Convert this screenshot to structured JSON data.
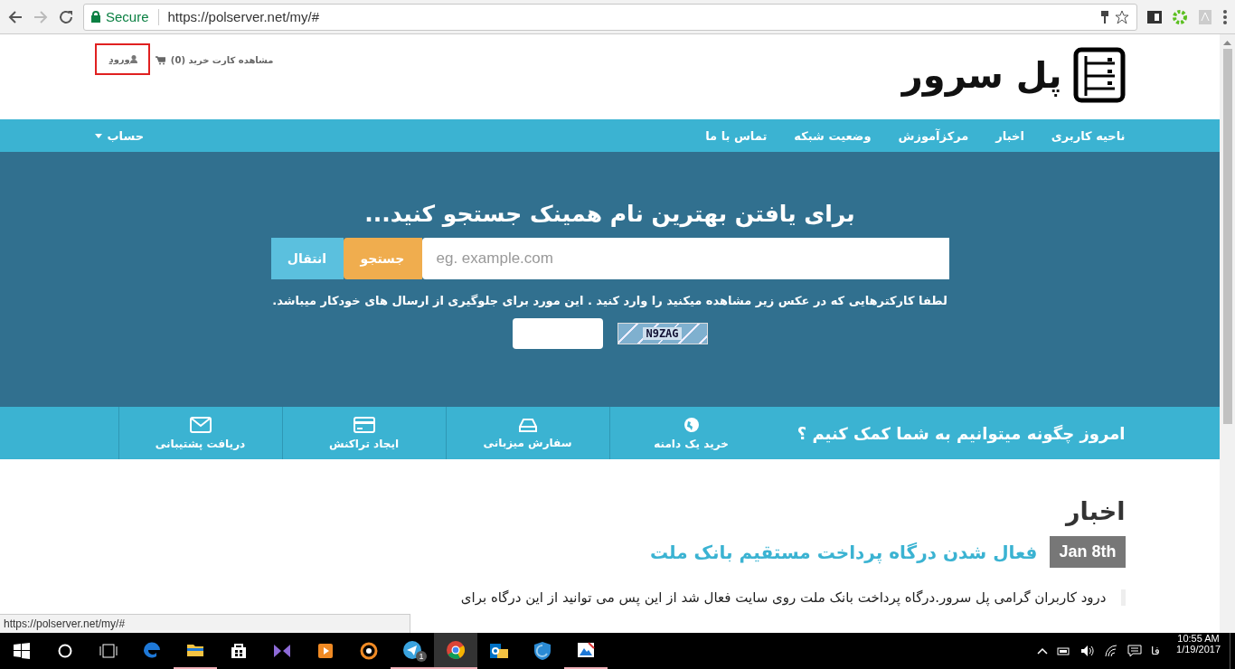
{
  "browser": {
    "forward_disabled": true,
    "secure_label": "Secure",
    "url": "https://polserver.net/my/#"
  },
  "header": {
    "login": "ورود",
    "cart": "مشاهده کارت خرید (0)",
    "logo": "پل سرور"
  },
  "nav": {
    "items": [
      "ناحیه کاربری",
      "اخبار",
      "مرکزآموزش",
      "وضعیت شبکه",
      "تماس با ما"
    ],
    "account": "حساب"
  },
  "hero": {
    "title": "برای یافتن بهترین نام همینک جستجو کنید...",
    "placeholder": "eg. example.com",
    "search_button": "جستجو",
    "transfer_button": "انتقال",
    "note": "لطفا کارکترهایی که در عکس زیر مشاهده میکنید را وارد کنید . این مورد برای جلوگیری از ارسال های خودکار میباشد.",
    "captcha": "N9ZAG"
  },
  "help": {
    "title": "امروز چگونه میتوانیم به شما کمک کنیم ؟",
    "items": [
      {
        "kind": "globe",
        "label": "خرید یک دامنه"
      },
      {
        "kind": "drive",
        "label": "سفارش میزبانی"
      },
      {
        "kind": "card",
        "label": "ایجاد تراکنش"
      },
      {
        "kind": "envelope",
        "label": "دریافت پشتیبانی"
      }
    ]
  },
  "news": {
    "heading": "اخبار",
    "date": "Jan 8th",
    "title": "فعال شدن درگاه پرداخت مستقیم بانک ملت",
    "body": "درود کاربران گرامی پل سرور.درگاه پرداخت بانک ملت روی سایت فعال شد از این پس می توانید از این درگاه برای"
  },
  "status_url": "https://polserver.net/my/#",
  "taskbar": {
    "apps": [
      {
        "kind": "edge",
        "running": false,
        "selected": false
      },
      {
        "kind": "folder",
        "running": true,
        "selected": false
      },
      {
        "kind": "store",
        "running": false,
        "selected": false
      },
      {
        "kind": "studio",
        "running": false,
        "selected": false
      },
      {
        "kind": "player",
        "running": false,
        "selected": false
      },
      {
        "kind": "bird",
        "running": false,
        "selected": false
      },
      {
        "kind": "telegram",
        "running": true,
        "selected": false,
        "badge": "1"
      },
      {
        "kind": "chrome",
        "running": true,
        "selected": true
      },
      {
        "kind": "outlook",
        "running": false,
        "selected": false
      },
      {
        "kind": "shield",
        "running": false,
        "selected": false
      },
      {
        "kind": "paint",
        "running": true,
        "selected": false
      }
    ],
    "language": "فا",
    "time": "10:55 AM",
    "date": "1/19/2017"
  }
}
